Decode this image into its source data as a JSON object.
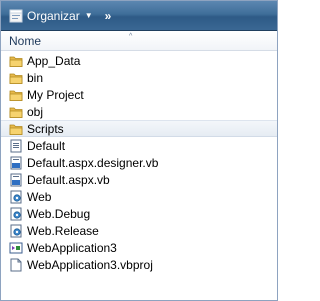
{
  "toolbar": {
    "organize_label": "Organizar",
    "organize_icon": "organize-icon",
    "caret": "▼",
    "more": "»"
  },
  "header": {
    "column_name": "Nome",
    "sort_indicator": "^"
  },
  "files": [
    {
      "name": "App_Data",
      "icon": "folder-icon"
    },
    {
      "name": "bin",
      "icon": "folder-icon"
    },
    {
      "name": "My Project",
      "icon": "folder-icon"
    },
    {
      "name": "obj",
      "icon": "folder-icon"
    },
    {
      "name": "Scripts",
      "icon": "folder-icon",
      "selected": true
    },
    {
      "name": "Default",
      "icon": "aspx-file-icon"
    },
    {
      "name": "Default.aspx.designer.vb",
      "icon": "vb-file-icon"
    },
    {
      "name": "Default.aspx.vb",
      "icon": "vb-file-icon"
    },
    {
      "name": "Web",
      "icon": "config-file-icon"
    },
    {
      "name": "Web.Debug",
      "icon": "config-file-icon"
    },
    {
      "name": "Web.Release",
      "icon": "config-file-icon"
    },
    {
      "name": "WebApplication3",
      "icon": "vs-solution-icon"
    },
    {
      "name": "WebApplication3.vbproj",
      "icon": "document-icon"
    }
  ]
}
